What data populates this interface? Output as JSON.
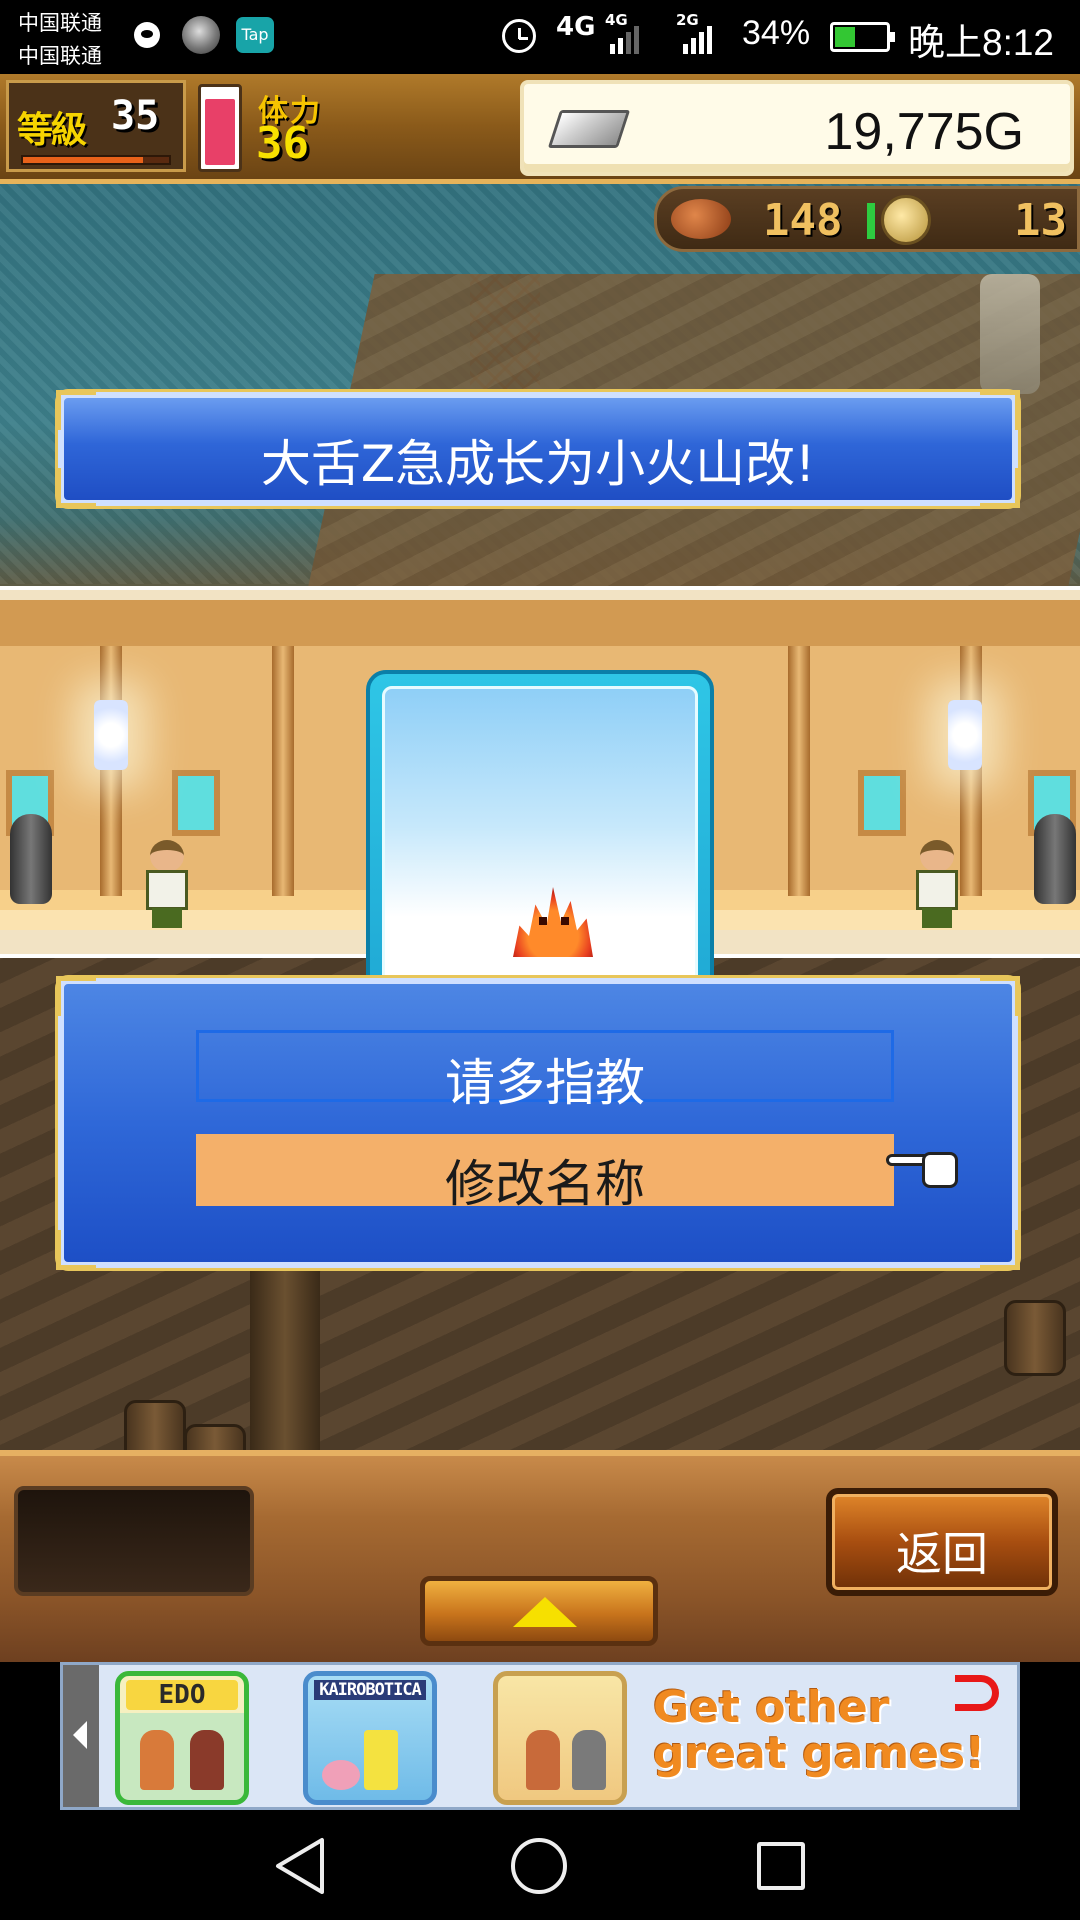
{
  "status_bar": {
    "carrier_1": "中国联通",
    "carrier_2": "中国联通",
    "app_badge": "Tap",
    "network_1": "4G",
    "network_2": "4G",
    "network_3": "2G",
    "battery_percent": "34%",
    "time": "晚上8:12",
    "icons": [
      "message-icon",
      "avatar-icon",
      "tap-app-icon",
      "alarm-icon",
      "signal-icon",
      "battery-charging-icon"
    ]
  },
  "hud": {
    "level_label": "等級",
    "level_value": "35",
    "level_exp_fraction": 0.82,
    "stamina_label": "体力",
    "stamina_value": "36",
    "stamina_fraction": 0.9,
    "gold_value": "19,775G",
    "food_value": "148",
    "medal_value": "13"
  },
  "banner": {
    "text": "大舌Z急成长为小火山改!"
  },
  "choices": {
    "option_1": "请多指教",
    "option_2": "修改名称",
    "selected_index": 1
  },
  "bottom_bar": {
    "back_label": "返回"
  },
  "ad": {
    "apps": [
      {
        "title": "EDO"
      },
      {
        "title": "KAIROBOTICA"
      },
      {
        "title": ""
      }
    ],
    "cta_line_1": "Get other",
    "cta_line_2": "great games!"
  },
  "colors": {
    "panel_blue": "#2f68d8",
    "selected_option": "#f4b06a",
    "stamina_pink": "#e84068",
    "hud_wood": "#8a5a1a",
    "cta_orange": "#f08a20"
  }
}
